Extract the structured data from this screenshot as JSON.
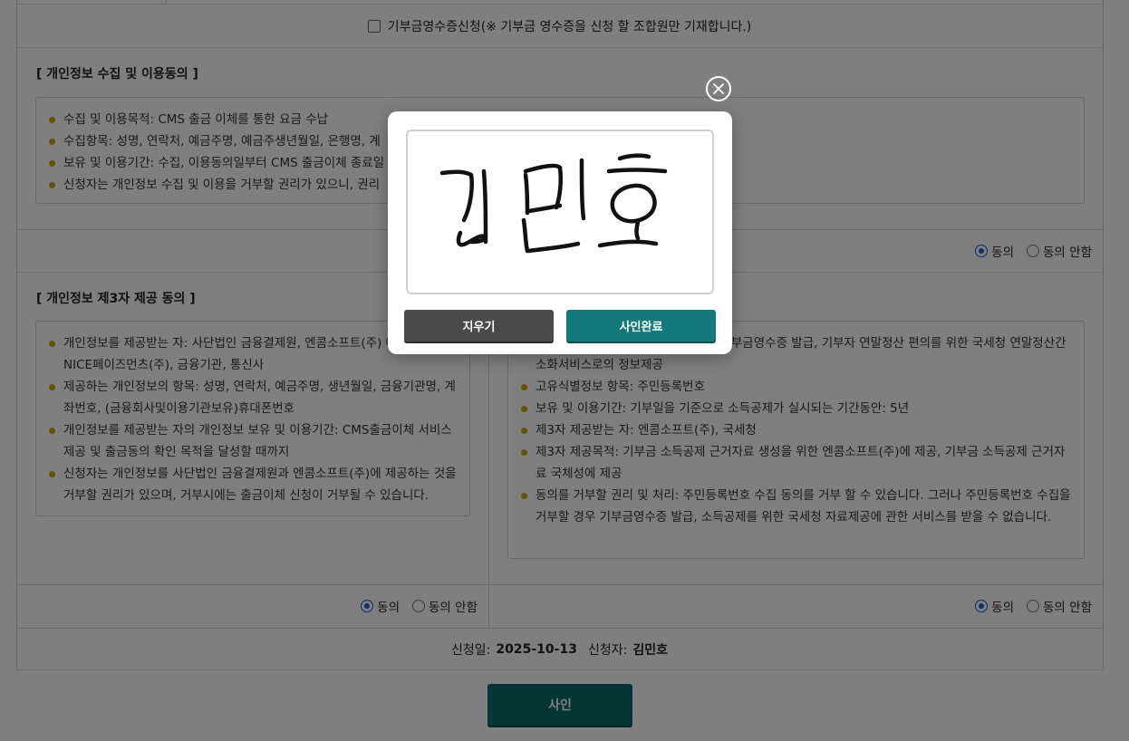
{
  "donation": {
    "label": "기부금영수증신청(※ 기부금 영수증을 신청 할 조합원만 기재합니다.)"
  },
  "section1": {
    "title": "[ 개인정보 수집 및 이용동의 ]",
    "items": [
      "수집 및 이용목적: CMS 출금 이체를 통한 요금 수납",
      "수집항목: 성명, 연락처, 예금주명, 예금주생년월일, 은행명, 계",
      "보유 및 이용기간: 수집, 이용동의일부터 CMS 출금이체 종료일",
      "신청자는 개인정보 수집 및 이용을 거부할 권리가 있으니, 권리"
    ],
    "agree": "동의",
    "disagree": "동의 안함"
  },
  "section2": {
    "title": "[ 개인정보 제3자 제공 동의 ]",
    "items": [
      "개인정보를 제공받는 자: 사단법인 금융결제원, 엔콤소프트(주) 에스(주), NICE페이즈먼츠(주), 금융기관, 통신사",
      "제공하는 개인정보의 항목: 성명, 연락처, 예금주명, 생년월일, 금융기관명, 계좌번호, (금융회사및이용기관보유)휴대폰번호",
      "개인정보를 제공받는 자의 개인정보 보유 및 이용기간: CMS출금이체 서비스 제공 및 출금동의 확인 목적을 달성할 때까지",
      "신청자는 개인정보를 사단법인 금융결제원과 엔콤소프트(주)에 제공하는 것을 거부할 권리가 있으며, 거부시에는 출금이체 신청이 거부될 수 있습니다."
    ],
    "agree": "동의",
    "disagree": "동의 안함"
  },
  "section3": {
    "items": [
      "자의 연말정산 소득공제증빙을 위한 기부금영수증 발급, 기부자 연말정산 편의를 위한 국세청 연말정산간소화서비스로의 정보제공",
      "고유식별정보 항목: 주민등록번호",
      "보유 및 이용기간: 기부일을 기준으로 소득공제가 실시되는 기간동안: 5년",
      "제3자 제공받는 자: 엔콤소프트(주), 국세청",
      "제3자 제공목적: 기부금 소득공제 근거자료 생성을 위한 엔콤소프트(주)에 제공, 기부금 소득공제 근거자료 국체성에 제공",
      "동의를 거부할 권리 및 처리: 주민등록번호 수집 동의를 거부 할 수 있습니다. 그러나 주민등록번호 수집을 거부할 경우 기부금영수증 발급, 소득공제를 위한 국세청 자료제공에 관한 서비스를 받을 수 없습니다."
    ],
    "agree": "동의",
    "disagree": "동의 안함"
  },
  "footer": {
    "date_label": "신청일:",
    "date": "2025-10-13",
    "applicant_label": "신청자:",
    "applicant": "김민호"
  },
  "sign_button": "사인",
  "modal": {
    "erase_label": "지우기",
    "done_label": "사인완료",
    "signature_text": "김민호"
  },
  "colors": {
    "accent": "#0d6a6d",
    "bullet": "#d4a000",
    "radio": "#1a5fd6"
  }
}
